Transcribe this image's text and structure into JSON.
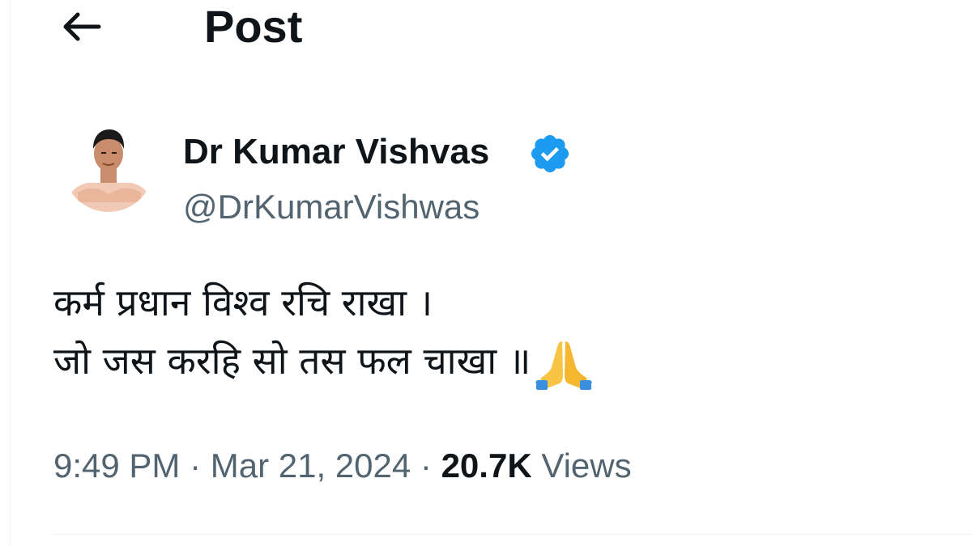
{
  "header": {
    "title": "Post",
    "back_icon": "arrow-left-icon"
  },
  "author": {
    "display_name": "Dr Kumar Vishvas",
    "handle": "@DrKumarVishwas",
    "verified_icon": "verified-badge-icon",
    "verified_color": "#1d9bf0"
  },
  "tweet": {
    "line1": "कर्म प्रधान विश्व रचि राखा ।",
    "line2": "जो जस करहि सो तस फल चाखा ॥",
    "emoji_icon": "folded-hands-icon"
  },
  "meta": {
    "time": "9:49 PM",
    "separator": " · ",
    "date": "Mar 21, 2024",
    "views_count": "20.7K",
    "views_label": " Views"
  },
  "colors": {
    "text_primary": "#0f1419",
    "text_secondary": "#536471",
    "accent": "#1d9bf0"
  }
}
